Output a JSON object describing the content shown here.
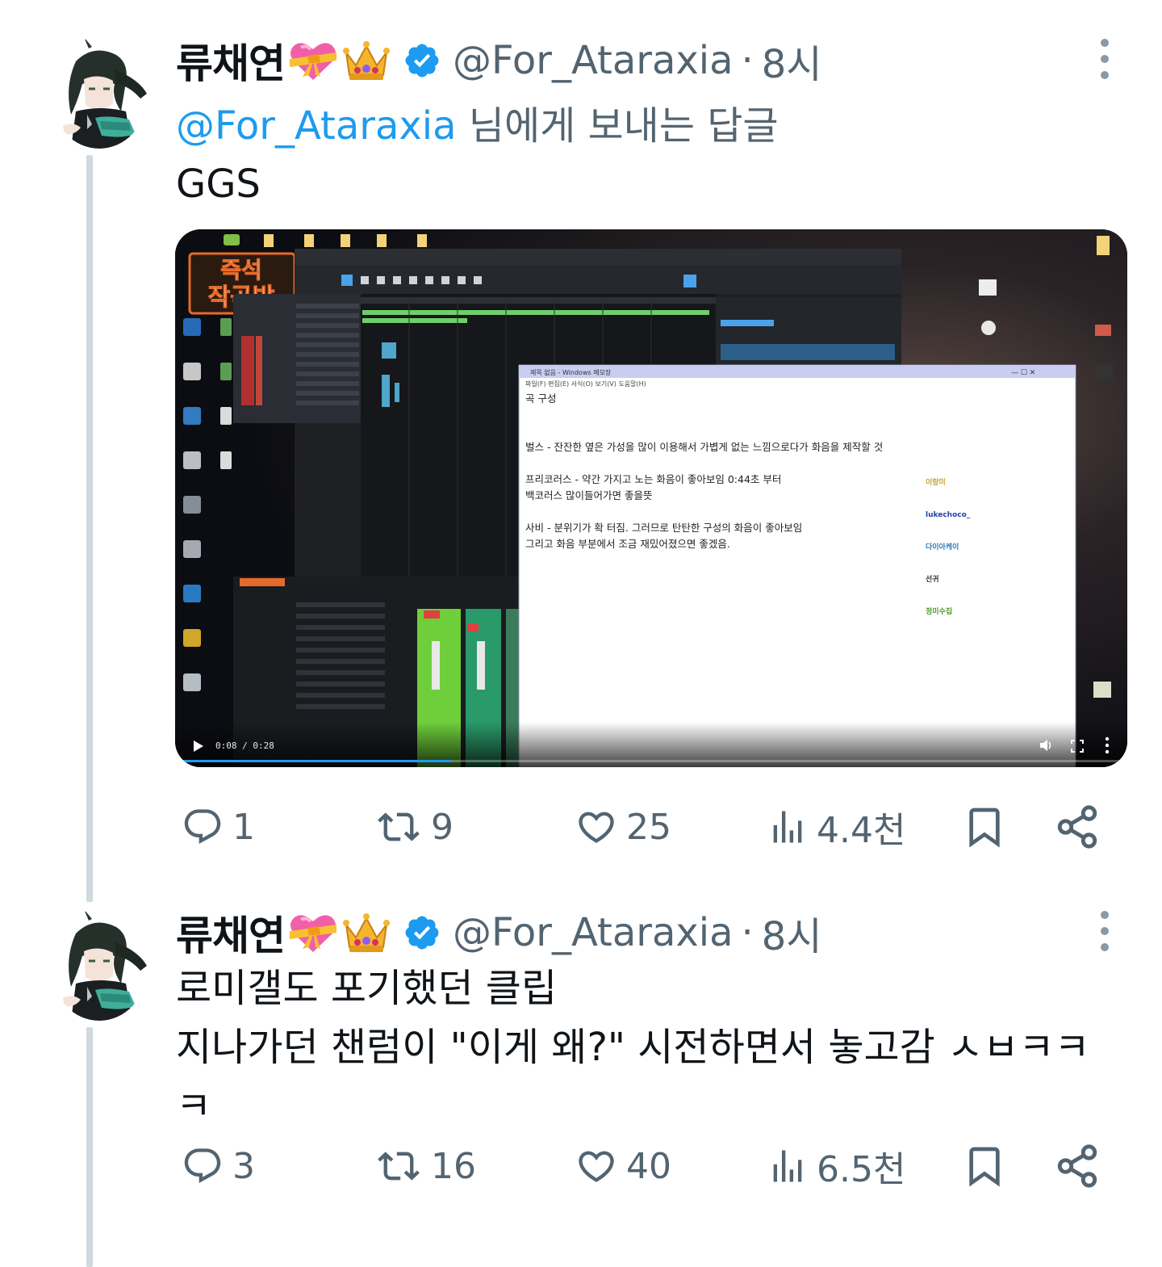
{
  "tweets": [
    {
      "author": {
        "name": "류채연",
        "handle": "@For_Ataraxia",
        "time": "8시"
      },
      "separator": "·",
      "reply_to": {
        "mention": "@For_Ataraxia",
        "suffix": " 님에게 보내는 답글"
      },
      "text": "GGS",
      "media": {
        "type": "video",
        "elapsed": "0:08 / 0:28",
        "progress": 0.29,
        "stamp_line1": "즉석",
        "stamp_line2": "작곡밥",
        "notepad": {
          "title": "제목 없음 - Windows 메모장",
          "menu": "파일(F)  편집(E)  서식(O)  보기(V)  도움말(H)",
          "lines": [
            "곡 구성",
            "",
            "",
            "벌스 - 잔잔한 옆은 가성을 많이 이용해서 가볍게 없는 느낌으로다가 화음을 제작할 것",
            "",
            "프리코러스 - 약간 가지고 노는 화음이 좋아보임   0:44초 부터",
            "백코러스 많이들어가면 좋을뜻",
            "",
            "사비 - 분위기가 확 터짐. 그러므로 탄탄한 구성의 화음이 좋아보임",
            "그리고 화음 부분에서 조금 재밌어졌으면 좋겠음."
          ]
        },
        "chat": [
          "이랑미",
          "lukechoco_",
          "다이아케이",
          "선귀",
          "정미수집"
        ]
      },
      "stats": {
        "replies": "1",
        "retweets": "9",
        "likes": "25",
        "views": "4.4천"
      }
    },
    {
      "author": {
        "name": "류채연",
        "handle": "@For_Ataraxia",
        "time": "8시"
      },
      "separator": "·",
      "text": "로미갤도 포기했던 클립\n지나가던 챈럼이 \"이게 왜?\" 시전하면서 놓고감 ㅅㅂㅋㅋㅋ",
      "stats": {
        "replies": "3",
        "retweets": "16",
        "likes": "40",
        "views": "6.5천"
      }
    }
  ],
  "icons": {
    "verified": "verified-badge-icon",
    "emoji1": "heart-with-ribbon-emoji",
    "emoji2": "crown-emoji",
    "reply": "reply-icon",
    "retweet": "retweet-icon",
    "like": "heart-icon",
    "views": "views-chart-icon",
    "bookmark": "bookmark-icon",
    "share": "share-icon",
    "more": "more-vertical-icon"
  },
  "colors": {
    "accent": "#1d9bf0",
    "muted": "#536471",
    "text": "#0f1419",
    "thread_line": "#cfd9de"
  }
}
